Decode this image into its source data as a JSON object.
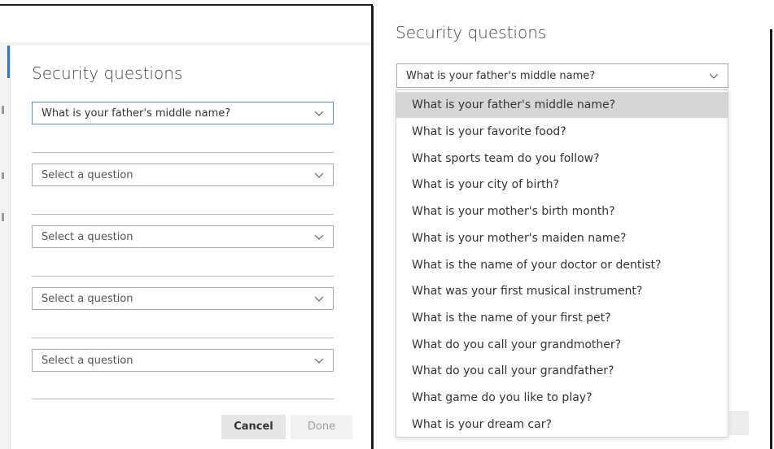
{
  "left_dialog": {
    "title": "Security questions",
    "questions": [
      {
        "value": "What is your father's middle name?",
        "focused": true,
        "placeholder": false
      },
      {
        "value": "Select a question",
        "focused": false,
        "placeholder": true
      },
      {
        "value": "Select a question",
        "focused": false,
        "placeholder": true
      },
      {
        "value": "Select a question",
        "focused": false,
        "placeholder": true
      },
      {
        "value": "Select a question",
        "focused": false,
        "placeholder": true
      }
    ],
    "cancel_label": "Cancel",
    "done_label": "Done"
  },
  "right_dialog": {
    "title": "Security questions",
    "selected_value": "What is your father's middle name?",
    "options": [
      "What is your father's middle name?",
      "What is your favorite food?",
      "What sports team do you follow?",
      "What is your city of birth?",
      "What is your mother's birth month?",
      "What is your mother's maiden name?",
      "What is the name of your doctor or dentist?",
      "What was your first musical instrument?",
      "What is the name of your first pet?",
      "What do you call your grandmother?",
      "What do you call your grandfather?",
      "What game do you like to play?",
      "What is your dream car?"
    ],
    "highlighted_option": "What is your father's middle name?"
  },
  "colors": {
    "focus_border": "#5e8fb7",
    "highlight_bg": "#d6d6d6",
    "accent_blue": "#2b79c5"
  },
  "icons": [
    "chevron-down-icon"
  ]
}
